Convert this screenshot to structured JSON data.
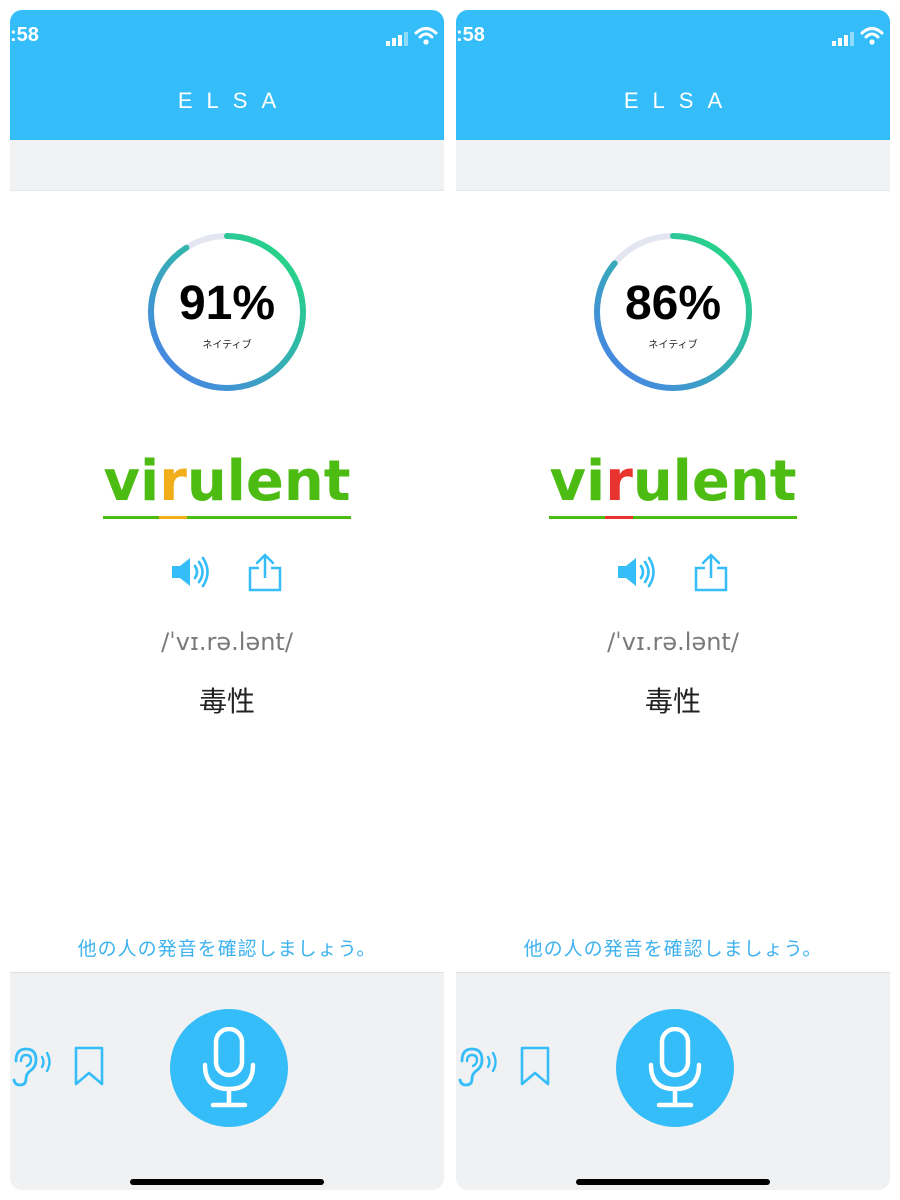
{
  "colors": {
    "brand": "#34bdf8",
    "correct": "#4cbc12",
    "warning": "#f2ad1b",
    "error": "#e8332e",
    "link": "#3fb2ee"
  },
  "panels": [
    {
      "status_time": ":58",
      "app_title": "ELSA",
      "score": {
        "value_text": "91%",
        "fraction": 0.91,
        "label": "ネイティブ"
      },
      "word": {
        "segments": [
          {
            "text": "vi",
            "quality": "good"
          },
          {
            "text": "r",
            "quality": "warning"
          },
          {
            "text": "ulent",
            "quality": "good"
          }
        ]
      },
      "ipa": "/ˈvɪ.rə.lənt/",
      "meaning": "毒性",
      "listen_link": "他の人の発音を確認しましょう。",
      "icons": {
        "speaker": "speaker-icon",
        "share": "share-icon",
        "ear": "ear-icon",
        "bookmark": "bookmark-icon",
        "mic": "microphone-icon"
      }
    },
    {
      "status_time": ":58",
      "app_title": "ELSA",
      "score": {
        "value_text": "86%",
        "fraction": 0.86,
        "label": "ネイティブ"
      },
      "word": {
        "segments": [
          {
            "text": "vi",
            "quality": "good"
          },
          {
            "text": "r",
            "quality": "bad"
          },
          {
            "text": "ulent",
            "quality": "good"
          }
        ]
      },
      "ipa": "/ˈvɪ.rə.lənt/",
      "meaning": "毒性",
      "listen_link": "他の人の発音を確認しましょう。",
      "icons": {
        "speaker": "speaker-icon",
        "share": "share-icon",
        "ear": "ear-icon",
        "bookmark": "bookmark-icon",
        "mic": "microphone-icon"
      }
    }
  ]
}
